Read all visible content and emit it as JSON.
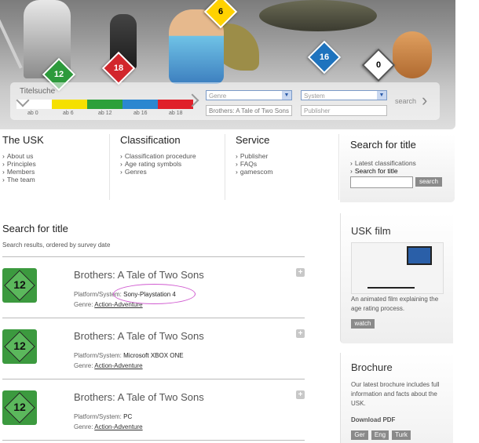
{
  "banner": {
    "dice": [
      "12",
      "18",
      "6",
      "16",
      "0"
    ],
    "search": {
      "label": "Titelsuche",
      "age_labels": [
        "ab 0",
        "ab 6",
        "ab 12",
        "ab 16",
        "ab 18"
      ],
      "age_colors": [
        "#ffffff",
        "#f5e000",
        "#2ca03a",
        "#2b87d0",
        "#e0202a"
      ],
      "genre_value": "Genre",
      "system_value": "System",
      "title_value": "Brothers: A Tale of Two Sons",
      "publisher_placeholder": "Publisher",
      "search_label": "search"
    }
  },
  "nav": {
    "usk": {
      "title": "The USK",
      "items": [
        "About us",
        "Principles",
        "Members",
        "The team"
      ]
    },
    "classification": {
      "title": "Classification",
      "items": [
        "Classification procedure",
        "Age rating symbols",
        "Genres"
      ]
    },
    "service": {
      "title": "Service",
      "items": [
        "Publisher",
        "FAQs",
        "gamescom"
      ]
    },
    "search": {
      "title": "Search for title",
      "items": [
        "Latest classifications",
        "Search for title"
      ],
      "button": "search"
    }
  },
  "main": {
    "title": "Search for title",
    "subtitle": "Search results, ordered by survey date",
    "platform_label": "Platform/System:",
    "genre_label": "Genre:",
    "results": [
      {
        "rating": "12",
        "title": "Brothers: A Tale of Two Sons",
        "platform": "Sony-Playstation 4",
        "genre": "Action-Adventure"
      },
      {
        "rating": "12",
        "title": "Brothers: A Tale of Two Sons",
        "platform": "Microsoft XBOX ONE",
        "genre": "Action-Adventure"
      },
      {
        "rating": "12",
        "title": "Brothers: A Tale of Two Sons",
        "platform": "PC",
        "genre": "Action-Adventure"
      }
    ]
  },
  "sidebar": {
    "film": {
      "title": "USK film",
      "text": "An animated film explaining the age rating process.",
      "button": "watch"
    },
    "brochure": {
      "title": "Brochure",
      "text": "Our latest brochure includes full information and facts about the USK.",
      "download": "Download PDF",
      "languages": [
        "Ger",
        "Eng",
        "Turk"
      ]
    }
  }
}
